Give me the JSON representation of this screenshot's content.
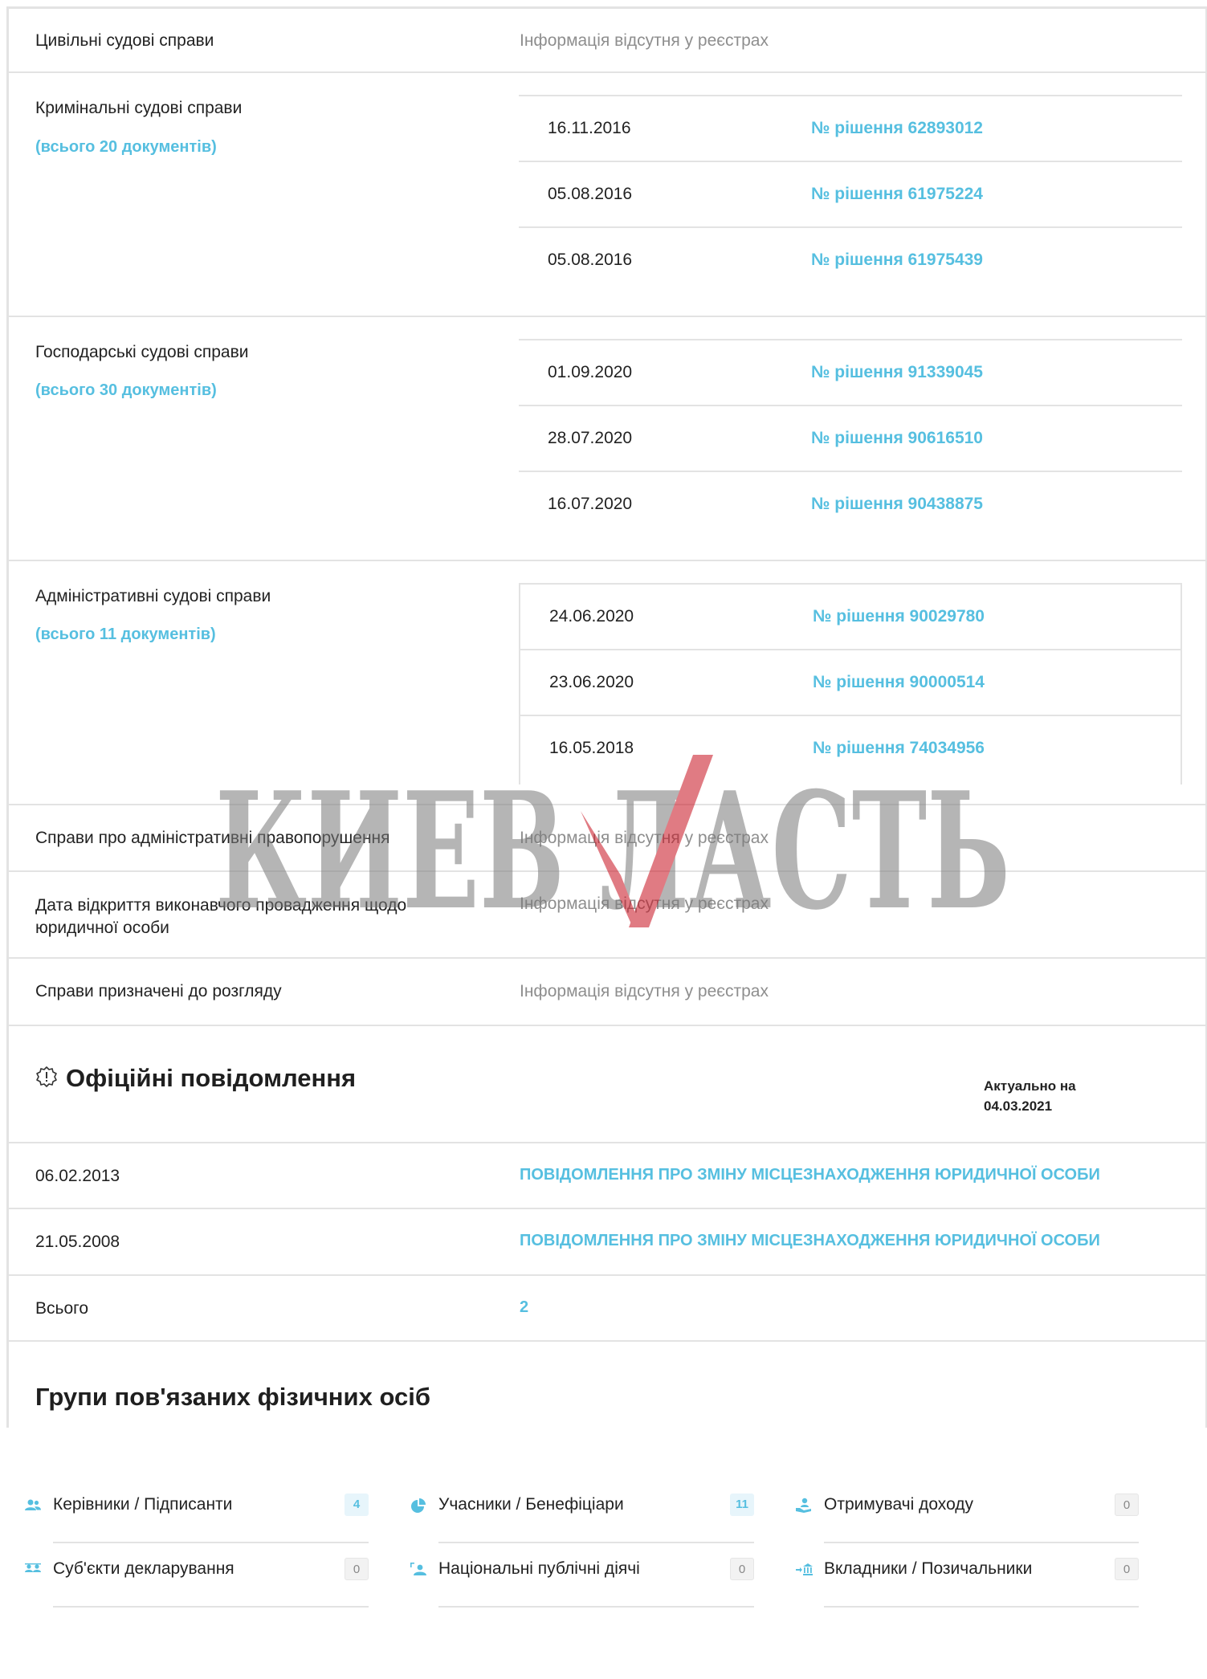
{
  "court": {
    "civil": {
      "label": "Цивільні судові справи",
      "value": "Інформація відсутня у реєстрах"
    },
    "criminal": {
      "label": "Кримінальні судові справи",
      "count": "(всього 20 документів)",
      "docs": [
        {
          "date": "16.11.2016",
          "num": "№ рішення 62893012"
        },
        {
          "date": "05.08.2016",
          "num": "№ рішення 61975224"
        },
        {
          "date": "05.08.2016",
          "num": "№ рішення 61975439"
        }
      ]
    },
    "commercial": {
      "label": "Господарські судові справи",
      "count": "(всього 30 документів)",
      "docs": [
        {
          "date": "01.09.2020",
          "num": "№ рішення 91339045"
        },
        {
          "date": "28.07.2020",
          "num": "№ рішення 90616510"
        },
        {
          "date": "16.07.2020",
          "num": "№ рішення 90438875"
        }
      ]
    },
    "administrative": {
      "label": "Адміністративні судові справи",
      "count": "(всього 11 документів)",
      "docs": [
        {
          "date": "24.06.2020",
          "num": "№ рішення 90029780"
        },
        {
          "date": "23.06.2020",
          "num": "№ рішення 90000514"
        },
        {
          "date": "16.05.2018",
          "num": "№ рішення 74034956"
        }
      ]
    },
    "offenses": {
      "label": "Справи про адміністративні правопорушення",
      "value": "Інформація відсутня у реєстрах"
    },
    "enforcement": {
      "label_line1": "Дата відкриття виконавчого провадження щодо",
      "label_line2": "юридичної особи",
      "value": "Інформація відсутня у реєстрах"
    },
    "scheduled": {
      "label": "Справи призначені до розгляду",
      "value": "Інформація відсутня у реєстрах"
    }
  },
  "notices": {
    "title": "Офіційні повідомлення",
    "asof_line1": "Актуально на",
    "asof_line2": "04.03.2021",
    "items": [
      {
        "date": "06.02.2013",
        "text": "ПОВІДОМЛЕННЯ ПРО ЗМІНУ МІСЦЕЗНАХОДЖЕННЯ ЮРИДИЧНОЇ ОСОБИ"
      },
      {
        "date": "21.05.2008",
        "text": "ПОВІДОМЛЕННЯ ПРО ЗМІНУ МІСЦЕЗНАХОДЖЕННЯ ЮРИДИЧНОЇ ОСОБИ"
      }
    ],
    "total_label": "Всього",
    "total_value": "2"
  },
  "groups": {
    "title": "Групи пов'язаних фізичних осіб",
    "items": [
      {
        "label": "Керівники / Підписанти",
        "count": "4",
        "icon": "users-icon"
      },
      {
        "label": "Учасники / Бенефіціари",
        "count": "11",
        "icon": "pie-chart-icon"
      },
      {
        "label": "Отримувачі доходу",
        "count": "0",
        "icon": "hand-user-icon"
      },
      {
        "label": "Суб'єкти декларування",
        "count": "0",
        "icon": "id-card-icon"
      },
      {
        "label": "Національні публічні діячі",
        "count": "0",
        "icon": "public-person-icon"
      },
      {
        "label": "Вкладники / Позичальники",
        "count": "0",
        "icon": "bank-icon"
      }
    ]
  },
  "colors": {
    "accent": "#56bfe0",
    "muted": "#8e8e8e",
    "border": "#e3e3e3"
  },
  "watermark": {
    "text": "КИЕВ ЛАСТЬ",
    "brand": "KievVlast"
  }
}
